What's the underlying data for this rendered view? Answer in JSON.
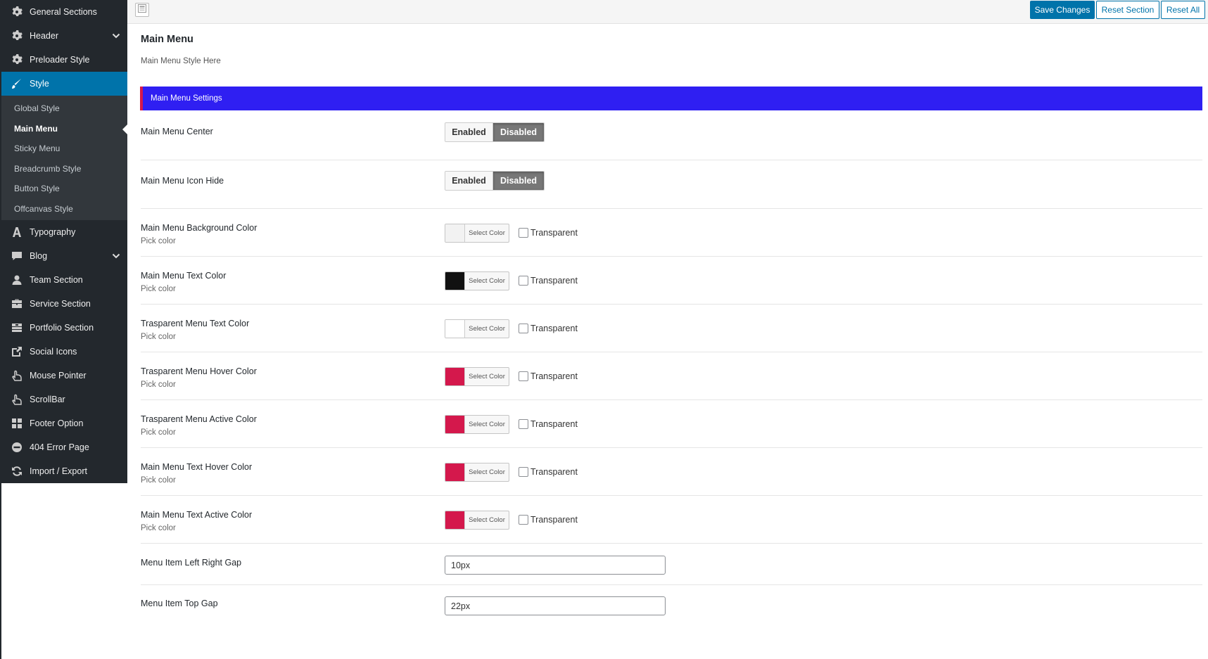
{
  "sidebar": {
    "items": [
      {
        "label": "General Sections",
        "icon": "gear-icon"
      },
      {
        "label": "Header",
        "icon": "gear-icon",
        "has_children": true
      },
      {
        "label": "Preloader Style",
        "icon": "gear-icon"
      },
      {
        "label": "Style",
        "icon": "brush-icon",
        "active": true
      }
    ],
    "style_children": [
      {
        "label": "Global Style"
      },
      {
        "label": "Main Menu",
        "current": true
      },
      {
        "label": "Sticky Menu"
      },
      {
        "label": "Breadcrumb Style"
      },
      {
        "label": "Button Style"
      },
      {
        "label": "Offcanvas Style"
      }
    ],
    "items_after": [
      {
        "label": "Typography",
        "icon": "typography-icon"
      },
      {
        "label": "Blog",
        "icon": "comment-icon",
        "has_children": true
      },
      {
        "label": "Team Section",
        "icon": "user-icon"
      },
      {
        "label": "Service Section",
        "icon": "briefcase-icon"
      },
      {
        "label": "Portfolio Section",
        "icon": "portfolio-icon"
      },
      {
        "label": "Social Icons",
        "icon": "share-icon"
      },
      {
        "label": "Mouse Pointer",
        "icon": "pointer-icon"
      },
      {
        "label": "ScrollBar",
        "icon": "pointer-icon"
      },
      {
        "label": "Footer Option",
        "icon": "grid-icon"
      },
      {
        "label": "404 Error Page",
        "icon": "minus-circle-icon"
      },
      {
        "label": "Import / Export",
        "icon": "refresh-icon"
      }
    ]
  },
  "toolbar": {
    "save_label": "Save Changes",
    "reset_section_label": "Reset Section",
    "reset_all_label": "Reset All"
  },
  "page": {
    "title": "Main Menu",
    "description": "Main Menu Style Here",
    "section_title": "Main Menu Settings"
  },
  "fields": {
    "menu_center": {
      "title": "Main Menu Center",
      "enabled_label": "Enabled",
      "disabled_label": "Disabled",
      "value": "Disabled"
    },
    "icon_hide": {
      "title": "Main Menu Icon Hide",
      "enabled_label": "Enabled",
      "disabled_label": "Disabled",
      "value": "Disabled"
    },
    "colors": [
      {
        "title": "Main Menu Background Color",
        "subtitle": "Pick color",
        "button_label": "Select Color",
        "transparent_label": "Transparent",
        "color": "#f2f2f2"
      },
      {
        "title": "Main Menu Text Color",
        "subtitle": "Pick color",
        "button_label": "Select Color",
        "transparent_label": "Transparent",
        "color": "#111111"
      },
      {
        "title": "Trasparent Menu Text Color",
        "subtitle": "Pick color",
        "button_label": "Select Color",
        "transparent_label": "Transparent",
        "color": "#ffffff"
      },
      {
        "title": "Trasparent Menu Hover Color",
        "subtitle": "Pick color",
        "button_label": "Select Color",
        "transparent_label": "Transparent",
        "color": "#d4184c"
      },
      {
        "title": "Trasparent Menu Active Color",
        "subtitle": "Pick color",
        "button_label": "Select Color",
        "transparent_label": "Transparent",
        "color": "#d4184c"
      },
      {
        "title": "Main Menu Text Hover Color",
        "subtitle": "Pick color",
        "button_label": "Select Color",
        "transparent_label": "Transparent",
        "color": "#d4184c"
      },
      {
        "title": "Main Menu Text Active Color",
        "subtitle": "Pick color",
        "button_label": "Select Color",
        "transparent_label": "Transparent",
        "color": "#d4184c"
      }
    ],
    "left_right_gap": {
      "title": "Menu Item Left Right Gap",
      "value": "10px"
    },
    "top_gap": {
      "title": "Menu Item Top Gap",
      "value": "22px"
    }
  },
  "colors": {
    "accent": "#0073aa",
    "section_bar": "#2f1ff2",
    "section_bar_border": "#d4184c",
    "sidebar_bg": "#23282d"
  }
}
